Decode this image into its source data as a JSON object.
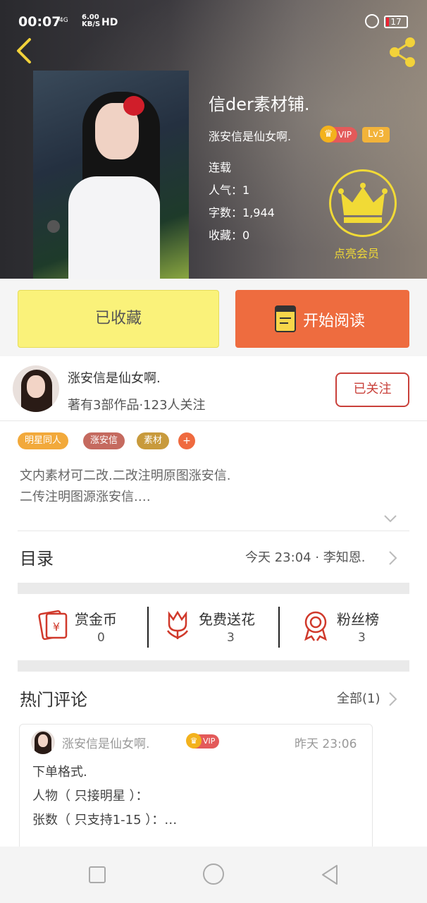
{
  "status_bar": {
    "time": "00:07",
    "signal": "4G",
    "speed_value": "6.00",
    "speed_unit": "KB/S",
    "hd": "HD",
    "battery": "17"
  },
  "book": {
    "title": "信der素材铺.",
    "author": "涨安信是仙女啊.",
    "vip": "VIP",
    "level": "Lv3",
    "status": "连载",
    "popularity": "人气：1",
    "word_count": "字数：1,944",
    "favorites": "收藏：0",
    "member_label": "点亮会员"
  },
  "actions": {
    "collected": "已收藏",
    "read": "开始阅读"
  },
  "writer": {
    "name": "涨安信是仙女啊.",
    "stats": "著有3部作品·123人关注",
    "follow": "已关注"
  },
  "tags": [
    {
      "label": "明星同人",
      "color": "#f2a93b"
    },
    {
      "label": "涨安信",
      "color": "#c56a5f"
    },
    {
      "label": "素材",
      "color": "#c89a3c"
    }
  ],
  "tag_add": "+",
  "description": {
    "line1": "文内素材可二改.二改注明原图涨安信.",
    "line2": "二传注明图源涨安信.…"
  },
  "toc": {
    "label": "目录",
    "latest": "今天 23:04 · 李知恩."
  },
  "stats": [
    {
      "label": "赏金币",
      "value": "0",
      "icon": "red-envelope-icon"
    },
    {
      "label": "免费送花",
      "value": "3",
      "icon": "flower-icon"
    },
    {
      "label": "粉丝榜",
      "value": "3",
      "icon": "medal-icon"
    }
  ],
  "hot_comments": {
    "label": "热门评论",
    "all": "全部(1)"
  },
  "comment": {
    "user": "涨安信是仙女啊.",
    "vip": "VIP",
    "time": "昨天 23:06",
    "line1": "下单格式.",
    "line2": "人物（ 只接明星 ）：",
    "line3": "张数（ 只支持1-15 ）：…"
  }
}
